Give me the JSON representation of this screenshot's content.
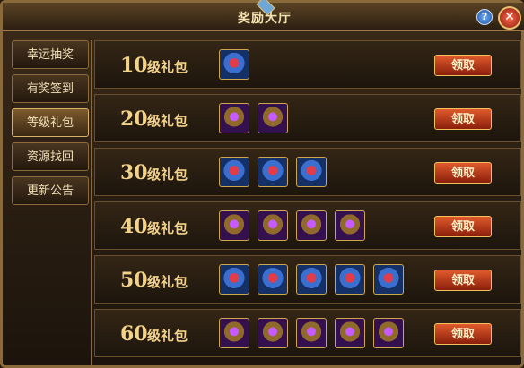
{
  "window": {
    "title": "奖励大厅",
    "help_label": "?",
    "close_label": "✕"
  },
  "sidebar": {
    "items": [
      {
        "label": "幸运抽奖"
      },
      {
        "label": "有奖签到"
      },
      {
        "label": "等级礼包"
      },
      {
        "label": "资源找回"
      },
      {
        "label": "更新公告"
      }
    ],
    "active_index": 2
  },
  "packages": [
    {
      "level": "10",
      "suffix": "级礼包",
      "items": [
        "ring-red-icon"
      ],
      "button": "领取"
    },
    {
      "level": "20",
      "suffix": "级礼包",
      "items": [
        "ring-purple-icon",
        "ring-purple-icon"
      ],
      "button": "领取"
    },
    {
      "level": "30",
      "suffix": "级礼包",
      "items": [
        "ring-red-icon",
        "ring-red-icon",
        "ring-red-icon"
      ],
      "button": "领取"
    },
    {
      "level": "40",
      "suffix": "级礼包",
      "items": [
        "ring-purple-icon",
        "ring-purple-icon",
        "ring-purple-icon",
        "ring-purple-icon"
      ],
      "button": "领取"
    },
    {
      "level": "50",
      "suffix": "级礼包",
      "items": [
        "ring-red-icon",
        "ring-red-icon",
        "ring-red-icon",
        "ring-red-icon",
        "ring-red-icon"
      ],
      "button": "领取"
    },
    {
      "level": "60",
      "suffix": "级礼包",
      "items": [
        "ring-purple-icon",
        "ring-purple-icon",
        "ring-purple-icon",
        "ring-purple-icon",
        "ring-purple-icon"
      ],
      "button": "领取"
    }
  ],
  "colors": {
    "accent_gold": "#f3d28a",
    "button_red": "#c0401c"
  }
}
